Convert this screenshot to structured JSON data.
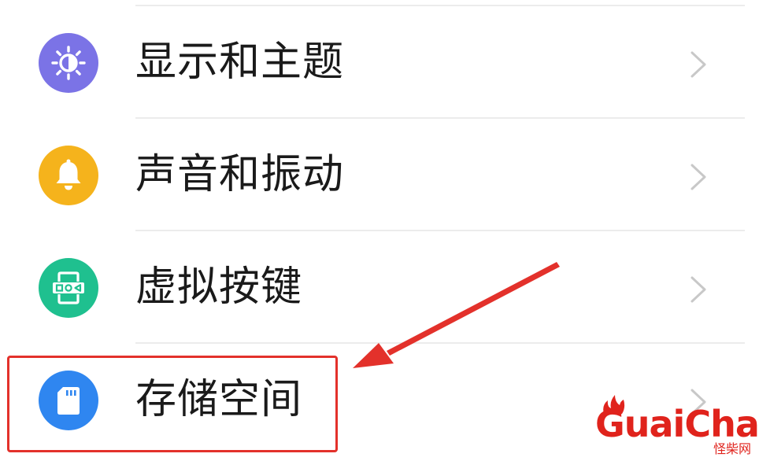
{
  "settings": {
    "items": [
      {
        "label": "显示和主题",
        "icon": "sun-icon",
        "color": "#7b73e6"
      },
      {
        "label": "声音和振动",
        "icon": "bell-icon",
        "color": "#f5b31c"
      },
      {
        "label": "虚拟按键",
        "icon": "virtual-keys-icon",
        "color": "#1fc08f"
      },
      {
        "label": "存储空间",
        "icon": "sd-card-icon",
        "color": "#2f86f0"
      }
    ]
  },
  "annotation": {
    "highlight_color": "#e3312b",
    "highlighted_item": "存储空间"
  },
  "watermark": {
    "brand": "GuaiChai",
    "subtitle": "怪柴网",
    "color": "#e0231c"
  }
}
